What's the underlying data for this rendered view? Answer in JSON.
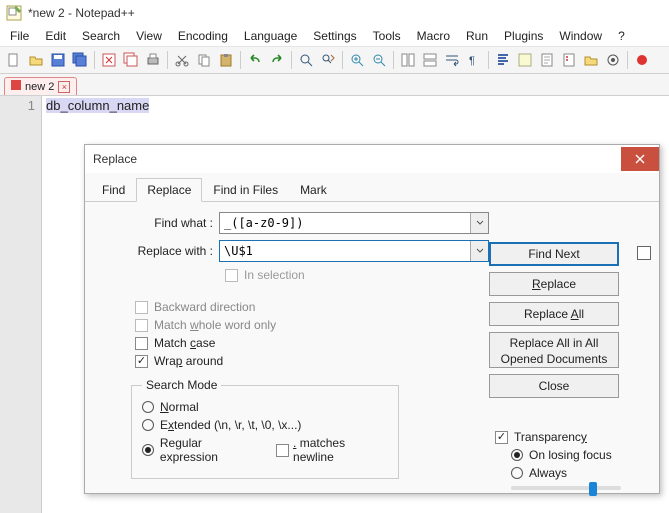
{
  "window": {
    "title": "*new 2 - Notepad++"
  },
  "menus": [
    "File",
    "Edit",
    "Search",
    "View",
    "Encoding",
    "Language",
    "Settings",
    "Tools",
    "Macro",
    "Run",
    "Plugins",
    "Window",
    "?"
  ],
  "document_tab": {
    "label": "new 2"
  },
  "editor": {
    "line_number": "1",
    "content": "db_column_name"
  },
  "dialog": {
    "title": "Replace",
    "tabs": {
      "find": "Find",
      "replace": "Replace",
      "find_in_files": "Find in Files",
      "mark": "Mark"
    },
    "find_what_label": "Find what :",
    "find_what_value": "_([a-z0-9])",
    "replace_with_label": "Replace with :",
    "replace_with_value": "\\U$1",
    "in_selection": "In selection",
    "backward": "Backward direction",
    "whole_word": "Match whole word only",
    "match_case": "Match case",
    "wrap_around": "Wrap around",
    "search_mode_legend": "Search Mode",
    "mode_normal": "Normal",
    "mode_extended": "Extended (\\n, \\r, \\t, \\0, \\x...)",
    "mode_regex": "Regular expression",
    "matches_newline": ". matches newline",
    "transparency": "Transparency",
    "on_losing_focus": "On losing focus",
    "always": "Always",
    "btn_find_next": "Find Next",
    "btn_replace": "Replace",
    "btn_replace_all": "Replace All",
    "btn_replace_all_opened": "Replace All in All Opened Documents",
    "btn_close": "Close"
  }
}
